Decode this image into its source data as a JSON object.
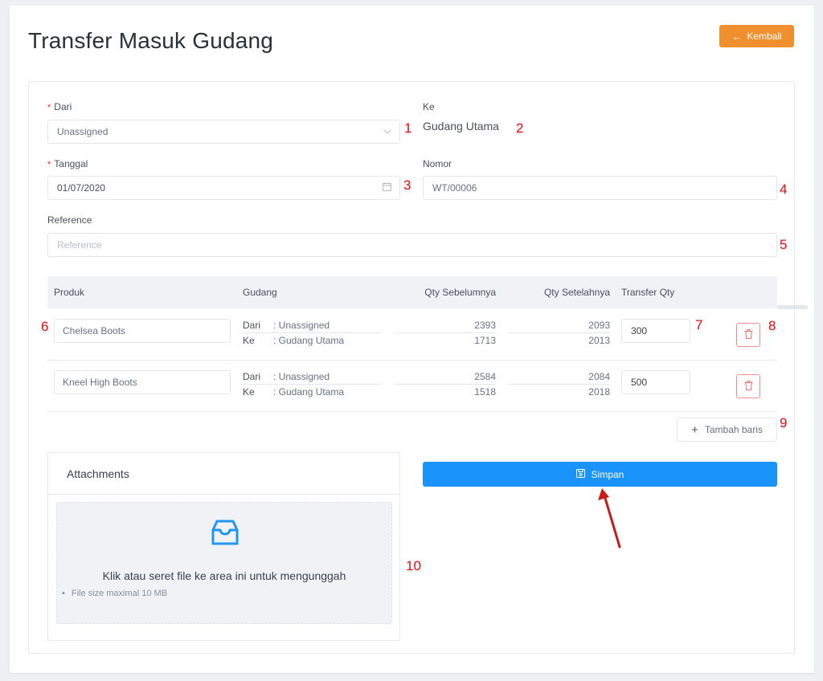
{
  "page": {
    "title": "Transfer Masuk Gudang",
    "back_button": "Kembali"
  },
  "form": {
    "dari": {
      "label": "Dari",
      "required": true,
      "value": "Unassigned"
    },
    "ke": {
      "label": "Ke",
      "value": "Gudang Utama"
    },
    "tanggal": {
      "label": "Tanggal",
      "required": true,
      "value": "01/07/2020"
    },
    "nomor": {
      "label": "Nomor",
      "value": "WT/00006"
    },
    "reference": {
      "label": "Reference",
      "placeholder": "Reference",
      "value": ""
    }
  },
  "table": {
    "headers": [
      "Produk",
      "Gudang",
      "Qty Sebelumnya",
      "Qty Setelahnya",
      "Transfer Qty"
    ],
    "rows": [
      {
        "product": "Chelsea Boots",
        "from_label": "Dari",
        "from_value": ": Unassigned",
        "to_label": "Ke",
        "to_value": ": Gudang Utama",
        "qty_before_from": "2393",
        "qty_before_to": "1713",
        "qty_after_from": "2093",
        "qty_after_to": "2013",
        "transfer_qty": "300"
      },
      {
        "product": "Kneel High Boots",
        "from_label": "Dari",
        "from_value": ": Unassigned",
        "to_label": "Ke",
        "to_value": ": Gudang Utama",
        "qty_before_from": "2584",
        "qty_before_to": "1518",
        "qty_after_from": "2084",
        "qty_after_to": "2018",
        "transfer_qty": "500"
      }
    ],
    "add_row_button": "Tambah baris"
  },
  "attachments": {
    "title": "Attachments",
    "hint": "Klik atau seret file ke area ini untuk mengunggah",
    "note": "File size maximal 10 MB"
  },
  "save_button": "Simpan",
  "annotations": [
    "1",
    "2",
    "3",
    "4",
    "5",
    "6",
    "7",
    "8",
    "9",
    "10"
  ],
  "colors": {
    "accent_orange": "#ef8f2e",
    "primary_blue": "#1a93fb",
    "danger_red": "#f38b8d",
    "annotation_red": "#e0141b"
  }
}
